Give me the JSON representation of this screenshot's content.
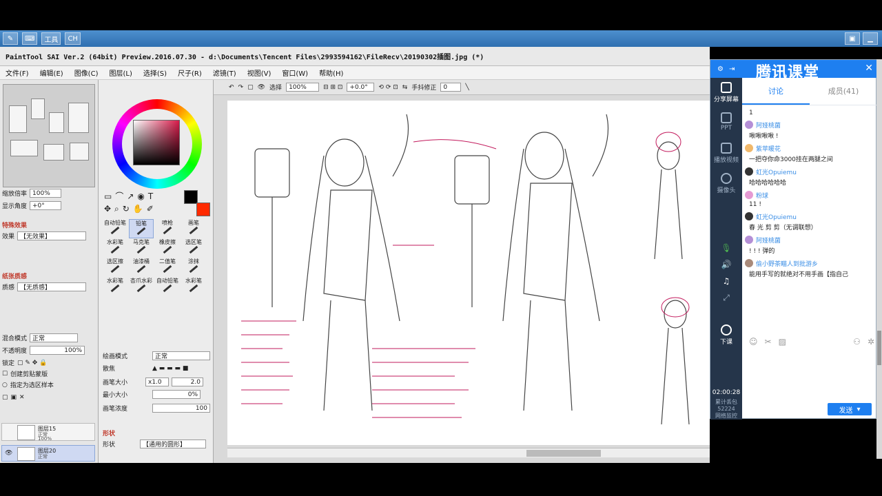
{
  "taskbar": {
    "menu1": "工具",
    "menu2": "CH"
  },
  "title": "PaintTool SAI Ver.2 (64bit) Preview.2016.07.30 - d:\\Documents\\Tencent Files\\2993594162\\FileRecv\\20190302插图.jpg (*)",
  "menu": [
    "文件(F)",
    "编辑(E)",
    "图像(C)",
    "图层(L)",
    "选择(S)",
    "尺子(R)",
    "滤镜(T)",
    "视图(V)",
    "窗口(W)",
    "帮助(H)"
  ],
  "navigator": {
    "zoom_label": "缩放倍率",
    "zoom_value": "100%",
    "angle_label": "显示角度",
    "angle_value": "+0°"
  },
  "effects": {
    "section": "特殊效果",
    "label": "效果",
    "value": "【无效果】"
  },
  "paper": {
    "section": "纸张质感",
    "label": "质感",
    "value": "【无质感】"
  },
  "blend": {
    "label": "混合模式",
    "value": "正常"
  },
  "opacity": {
    "label": "不透明度",
    "value": "100%"
  },
  "lock_label": "锁定",
  "clip_label": "创建剪贴蒙版",
  "ref_label": "指定为选区样本",
  "layers": [
    {
      "name": "图层15",
      "mode": "正常",
      "opacity": "100%"
    },
    {
      "name": "图层20",
      "mode": "正常",
      "opacity": "100%"
    }
  ],
  "tools": [
    "自动铅笔",
    "铅笔",
    "喷枪",
    "画笔",
    "水彩笔",
    "马克笔",
    "橡皮擦",
    "选区笔",
    "选区擦",
    "油漆桶",
    "二值笔",
    "涂抹",
    "水彩笔",
    "杏爪水彩",
    "自动铅笔",
    "水彩笔"
  ],
  "brush": {
    "mode_label": "绘画模式",
    "mode_value": "正常",
    "scatter_label": "散焦",
    "size_label": "画笔大小",
    "size_mult": "x1.0",
    "size_value": "2.0",
    "min_label": "最小大小",
    "min_value": "0%",
    "density_label": "画笔浓度",
    "density_value": "100",
    "shape_section": "形状",
    "shape_label": "形状",
    "shape_value": "【通用的圆形】"
  },
  "canvas_toolbar": {
    "select_label": "选择",
    "zoom": "100%",
    "angle": "+0.0°",
    "stabilizer_label": "手抖修正",
    "stabilizer_value": "0"
  },
  "tencent": {
    "logo": "腾讯课堂",
    "tab_discuss": "讨论",
    "tab_members": "成员(41)",
    "side_share": "分享屏幕",
    "side_ppt": "PPT",
    "side_video": "播放视频",
    "side_camera": "摄像头",
    "side_end": "下课",
    "timer": "02:00:28",
    "stats": "累计丢包\n52224\n网络监控",
    "messages": [
      {
        "user": "",
        "text": "1"
      },
      {
        "user": "阿娅桃菌",
        "text": "啾啾啾啾 !"
      },
      {
        "user": "紫苹暖花",
        "text": "一把夺你命3000挂在两腿之间"
      },
      {
        "user": "虹光Opuiemu",
        "text": "哈哈哈哈哈哈"
      },
      {
        "user": "粉球",
        "text": "11 !"
      },
      {
        "user": "虹光Opuiemu",
        "text": "春 光 剪 剪（无调联想）"
      },
      {
        "user": "阿娅桃菌",
        "text": "! ! ! 弹的"
      },
      {
        "user": "偷小野茶瞄人到批游乡",
        "text": "能用手写的就绝对不用手画【指自己"
      }
    ],
    "send": "发送"
  },
  "colors": {
    "accent": "#1e7ff0",
    "sidebar": "#25354a",
    "primary_color": "#000000",
    "secondary_color": "#ff2a00"
  }
}
